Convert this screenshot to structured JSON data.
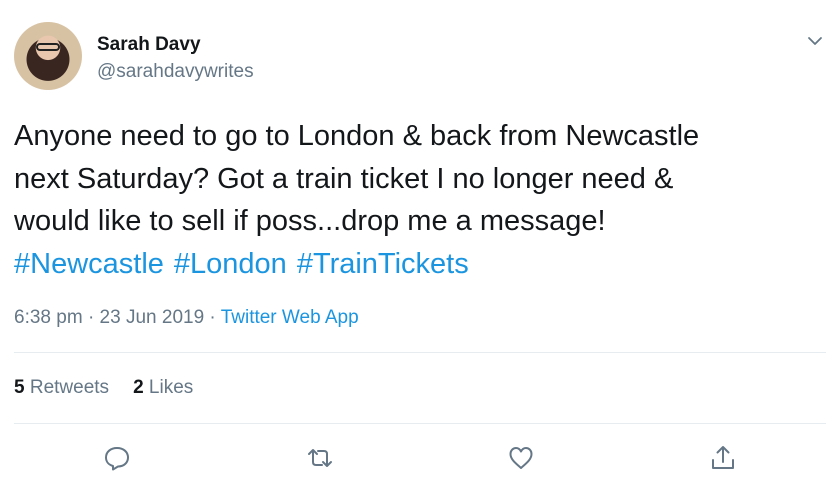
{
  "author": {
    "name": "Sarah Davy",
    "handle": "@sarahdavywrites"
  },
  "tweet": {
    "text_lines": [
      "Anyone need to go to London & back from Newcastle",
      "next Saturday? Got a train ticket I no longer need &",
      "would like to sell if poss...drop me a message!"
    ],
    "hashtags": [
      "#Newcastle",
      "#London",
      "#TrainTickets"
    ]
  },
  "meta": {
    "time": "6:38 pm",
    "separator": "·",
    "date": "23 Jun 2019",
    "source": "Twitter Web App"
  },
  "stats": {
    "retweets_count": "5",
    "retweets_label": "Retweets",
    "likes_count": "2",
    "likes_label": "Likes"
  },
  "icons": {
    "menu": "chevron-down-icon",
    "reply": "reply-icon",
    "retweet": "retweet-icon",
    "like": "heart-icon",
    "share": "share-icon"
  },
  "colors": {
    "link": "#1b95e0",
    "muted": "#657786",
    "text": "#14171a",
    "divider": "#e6ecf0"
  }
}
